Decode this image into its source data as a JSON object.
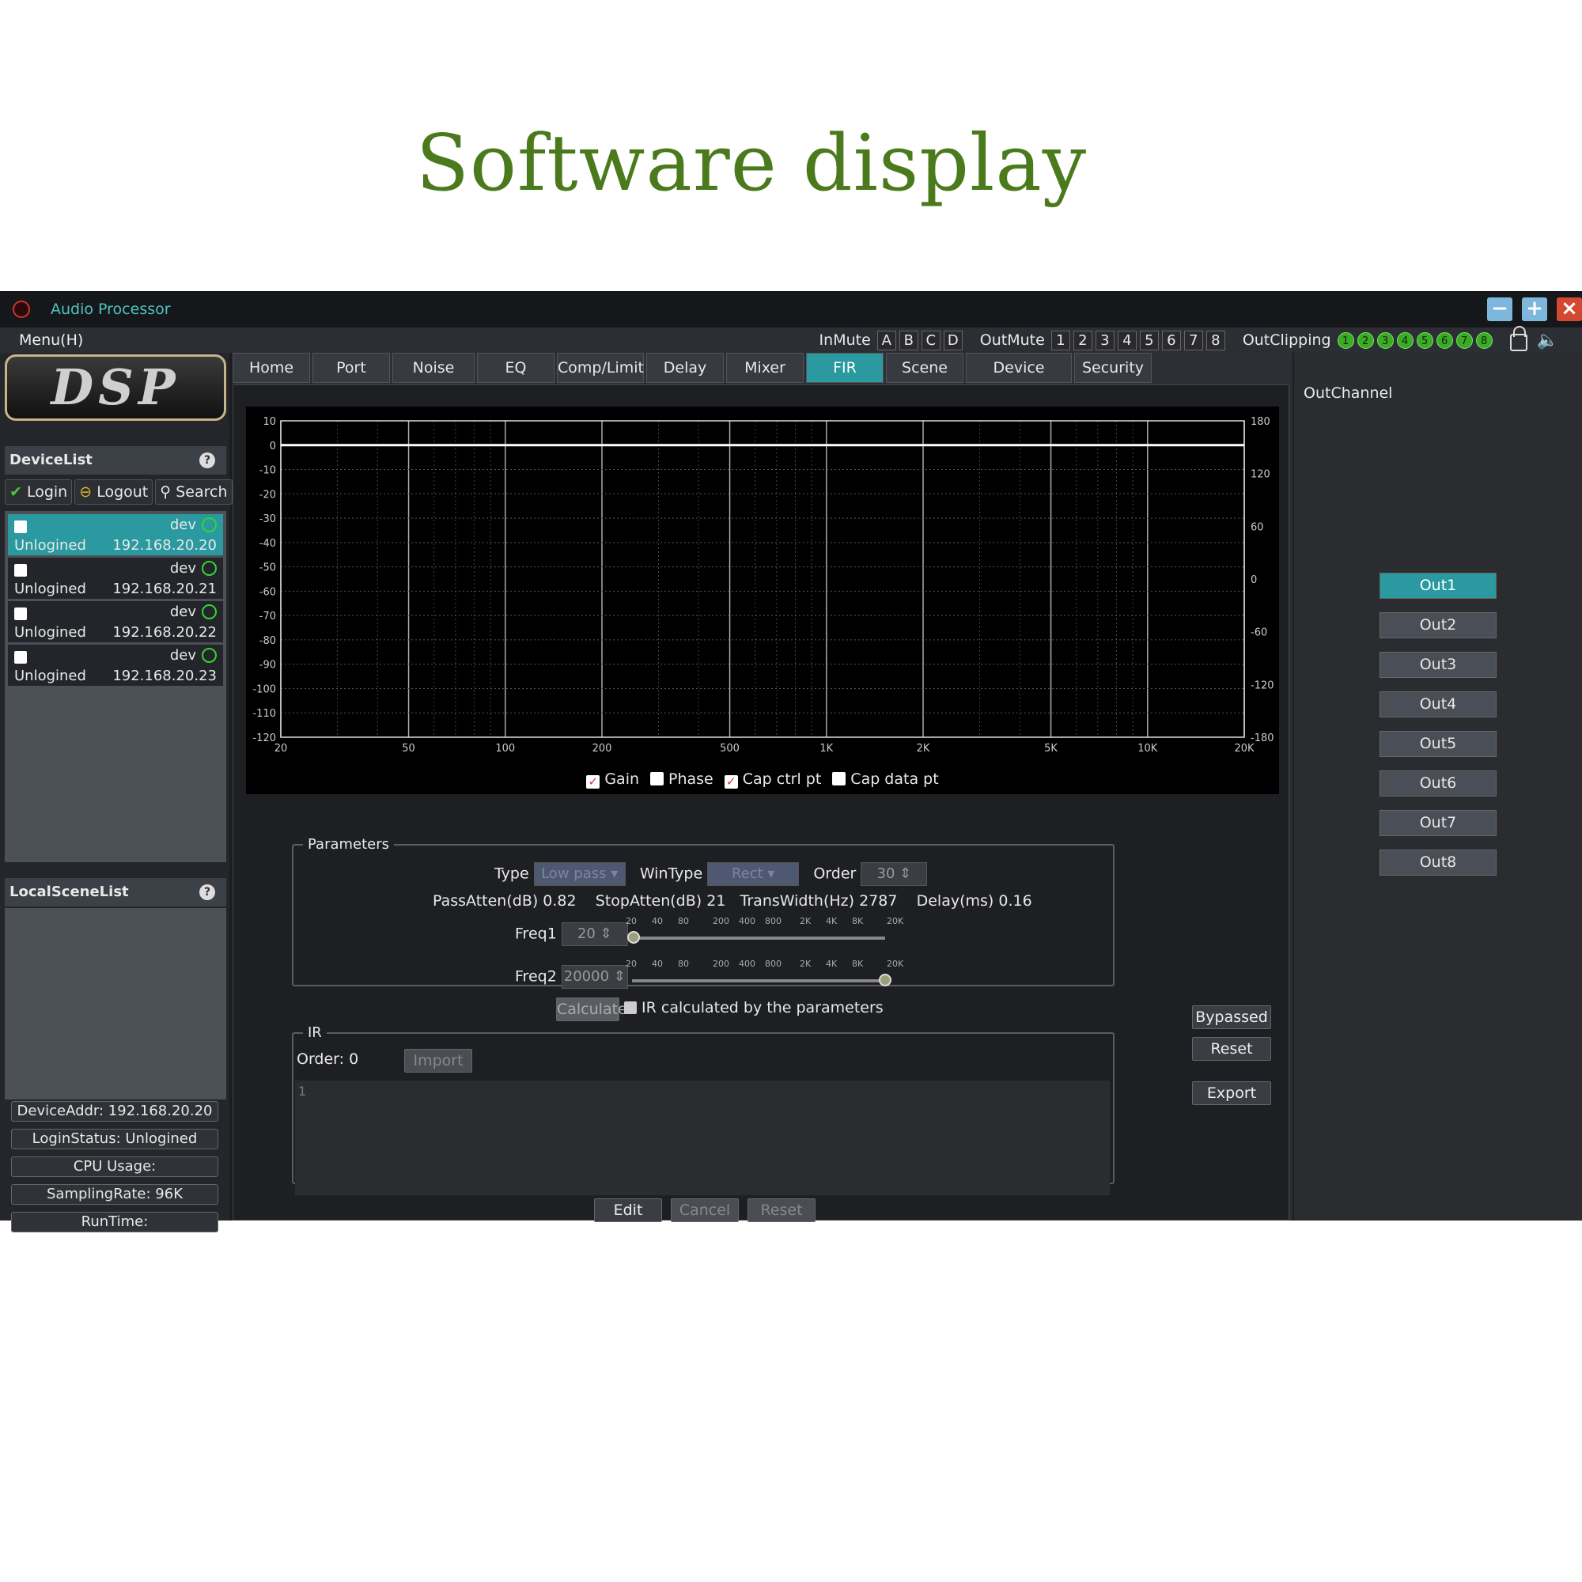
{
  "heading": "Software display",
  "window": {
    "title": "Audio Processor"
  },
  "menu": {
    "label": "Menu(H)"
  },
  "inmute": {
    "label": "InMute",
    "items": [
      "A",
      "B",
      "C",
      "D"
    ]
  },
  "outmute": {
    "label": "OutMute",
    "items": [
      "1",
      "2",
      "3",
      "4",
      "5",
      "6",
      "7",
      "8"
    ]
  },
  "outclipping": {
    "label": "OutClipping",
    "items": [
      "1",
      "2",
      "3",
      "4",
      "5",
      "6",
      "7",
      "8"
    ]
  },
  "logo": "DSP",
  "devicelist": {
    "title": "DeviceList",
    "login": "Login",
    "logout": "Logout",
    "search": "Search",
    "devices": [
      {
        "name": "dev",
        "status": "Unlogined",
        "ip": "192.168.20.20",
        "selected": true
      },
      {
        "name": "dev",
        "status": "Unlogined",
        "ip": "192.168.20.21"
      },
      {
        "name": "dev",
        "status": "Unlogined",
        "ip": "192.168.20.22"
      },
      {
        "name": "dev",
        "status": "Unlogined",
        "ip": "192.168.20.23"
      }
    ]
  },
  "localscenelist": {
    "title": "LocalSceneList"
  },
  "info": {
    "device_addr": "DeviceAddr: 192.168.20.20",
    "login_status": "LoginStatus: Unlogined",
    "cpu": "CPU Usage:",
    "sampling": "SamplingRate:  96K",
    "runtime": "RunTime:"
  },
  "tabs": [
    "Home",
    "Port",
    "Noise Gate",
    "EQ",
    "Comp/Limit",
    "Delay",
    "Mixer",
    "FIR",
    "Scene",
    "Device Setting",
    "Security"
  ],
  "active_tab": "FIR",
  "chart_data": {
    "type": "line",
    "x_ticks": [
      "20",
      "50",
      "100",
      "200",
      "500",
      "1K",
      "2K",
      "5K",
      "10K",
      "20K"
    ],
    "y_left_ticks": [
      "10",
      "0",
      "-10",
      "-20",
      "-30",
      "-40",
      "-50",
      "-60",
      "-70",
      "-80",
      "-90",
      "-100",
      "-110",
      "-120"
    ],
    "y_right_ticks": [
      "180",
      "120",
      "60",
      "0",
      "-60",
      "-120",
      "-180"
    ],
    "x_scale": "log",
    "xlim": [
      20,
      20000
    ],
    "ylim": [
      -120,
      10
    ],
    "y2lim": [
      -180,
      180
    ],
    "series": [
      {
        "color": "#ffffff",
        "x": [
          20,
          20000
        ],
        "y": [
          0,
          0
        ]
      }
    ],
    "legend": [
      {
        "label": "Gain",
        "checked": true
      },
      {
        "label": "Phase",
        "checked": false
      },
      {
        "label": "Cap ctrl pt",
        "checked": true
      },
      {
        "label": "Cap data pt",
        "checked": false
      }
    ]
  },
  "parameters": {
    "title": "Parameters",
    "type_label": "Type",
    "type_value": "Low pass",
    "wintype_label": "WinType",
    "wintype_value": "Rect",
    "order_label": "Order",
    "order_value": "30",
    "passatten": "PassAtten(dB) 0.82",
    "stopatten": "StopAtten(dB) 21",
    "transwidth": "TransWidth(Hz) 2787",
    "delay": "Delay(ms) 0.16",
    "freq1_label": "Freq1",
    "freq1_value": "20",
    "freq2_label": "Freq2",
    "freq2_value": "20000",
    "slider_ticks": [
      "20",
      "40",
      "80",
      "200",
      "400",
      "800",
      "2K",
      "4K",
      "8K",
      "20K"
    ],
    "freq1_level": 0,
    "freq2_level": 1
  },
  "calculate": {
    "button": "Calculate",
    "checkbox": "IR calculated by the parameters"
  },
  "ir": {
    "title": "IR",
    "order": "Order: 0",
    "import": "Import",
    "line": "1"
  },
  "bottom_buttons": {
    "edit": "Edit",
    "cancel": "Cancel",
    "reset": "Reset"
  },
  "side_buttons": {
    "bypassed": "Bypassed",
    "reset": "Reset",
    "export": "Export"
  },
  "outchannel": {
    "title": "OutChannel",
    "items": [
      "Out1",
      "Out2",
      "Out3",
      "Out4",
      "Out5",
      "Out6",
      "Out7",
      "Out8"
    ],
    "active": "Out1"
  },
  "colors": {
    "accent": "#2a9aa0",
    "heading": "#4a7a1c",
    "clip_on": "#3caa25",
    "close": "#d24830"
  }
}
